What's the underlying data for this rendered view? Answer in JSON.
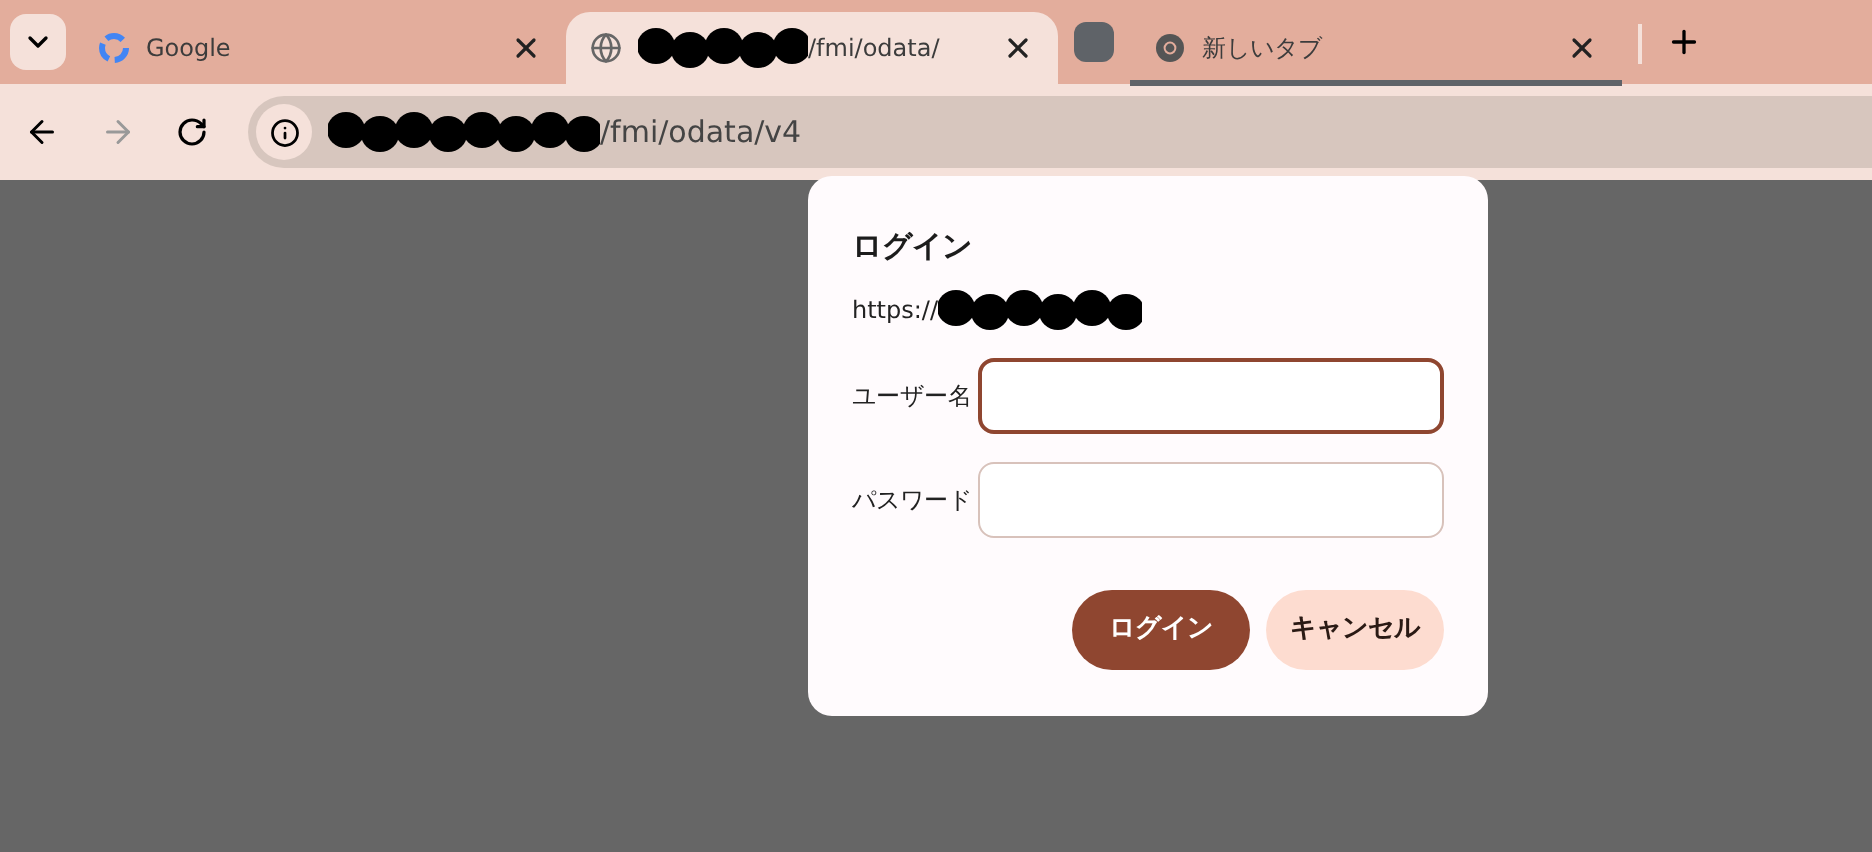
{
  "tabs": [
    {
      "title": "Google",
      "kind": "google",
      "selected": false
    },
    {
      "title": "/fmi/odata/",
      "kind": "globe",
      "redacted": true,
      "selected": true
    },
    {
      "title": "新しいタブ",
      "kind": "chrome",
      "grouped": true,
      "selected": false
    }
  ],
  "address_bar": {
    "url": "/fmi/odata/v4",
    "redacted": true
  },
  "dialog": {
    "title": "ログイン",
    "origin": "https://",
    "origin_redacted": true,
    "fields": [
      {
        "label": "ユーザー名",
        "focused": true
      },
      {
        "label": "パスワード",
        "focused": false
      }
    ],
    "buttons": [
      {
        "label": "ログイン",
        "kind": "primary"
      },
      {
        "label": "キャンセル",
        "kind": "secondary"
      }
    ]
  }
}
